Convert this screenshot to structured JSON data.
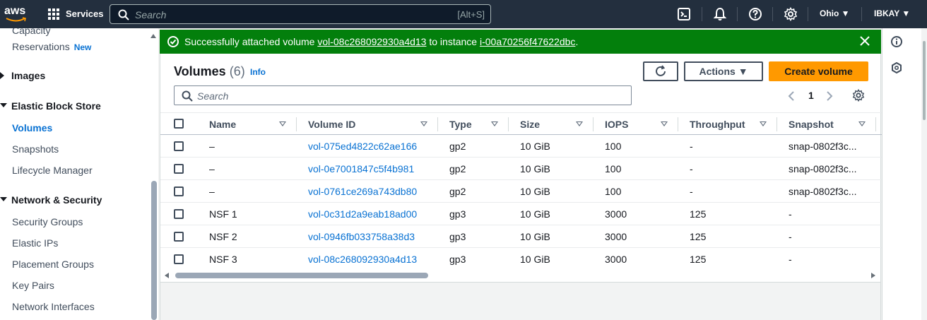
{
  "topnav": {
    "logo_text": "aws",
    "services_label": "Services",
    "search_placeholder": "Search",
    "search_shortcut": "[Alt+S]",
    "region": "Ohio",
    "account": "IBKAY",
    "icons": [
      "grid-icon",
      "search-icon",
      "cloudshell-icon",
      "bell-icon",
      "help-icon",
      "settings-icon"
    ]
  },
  "sidebar": {
    "capacity_reservations_line1": "Capacity",
    "capacity_reservations_line2": "Reservations",
    "new_badge": "New",
    "images_label": "Images",
    "ebs_label": "Elastic Block Store",
    "volumes_label": "Volumes",
    "snapshots_label": "Snapshots",
    "lifecycle_label": "Lifecycle Manager",
    "netsec_label": "Network & Security",
    "security_groups_label": "Security Groups",
    "elastic_ips_label": "Elastic IPs",
    "placement_groups_label": "Placement Groups",
    "key_pairs_label": "Key Pairs",
    "network_interfaces_label": "Network Interfaces"
  },
  "flash": {
    "prefix": "Successfully attached volume ",
    "volume_link": "vol-08c268092930a4d13",
    "middle": " to instance ",
    "instance_link": "i-00a70256f47622dbc",
    "suffix": ".",
    "color": "#037f0c"
  },
  "panel": {
    "title": "Volumes",
    "count": "(6)",
    "info_label": "Info",
    "actions_label": "Actions",
    "create_label": "Create volume",
    "search_placeholder": "Search",
    "page_number": "1",
    "accent": "#ff9900"
  },
  "table": {
    "columns": [
      "Name",
      "Volume ID",
      "Type",
      "Size",
      "IOPS",
      "Throughput",
      "Snapshot"
    ],
    "rows": [
      {
        "name": "–",
        "volume_id": "vol-075ed4822c62ae166",
        "type": "gp2",
        "size": "10 GiB",
        "iops": "100",
        "throughput": "-",
        "snapshot": "snap-0802f3c..."
      },
      {
        "name": "–",
        "volume_id": "vol-0e7001847c5f4b981",
        "type": "gp2",
        "size": "10 GiB",
        "iops": "100",
        "throughput": "-",
        "snapshot": "snap-0802f3c..."
      },
      {
        "name": "–",
        "volume_id": "vol-0761ce269a743db80",
        "type": "gp2",
        "size": "10 GiB",
        "iops": "100",
        "throughput": "-",
        "snapshot": "snap-0802f3c..."
      },
      {
        "name": "NSF 1",
        "volume_id": "vol-0c31d2a9eab18ad00",
        "type": "gp3",
        "size": "10 GiB",
        "iops": "3000",
        "throughput": "125",
        "snapshot": "-"
      },
      {
        "name": "NSF 2",
        "volume_id": "vol-0946fb033758a38d3",
        "type": "gp3",
        "size": "10 GiB",
        "iops": "3000",
        "throughput": "125",
        "snapshot": "-"
      },
      {
        "name": "NSF 3",
        "volume_id": "vol-08c268092930a4d13",
        "type": "gp3",
        "size": "10 GiB",
        "iops": "3000",
        "throughput": "125",
        "snapshot": "-"
      }
    ]
  }
}
